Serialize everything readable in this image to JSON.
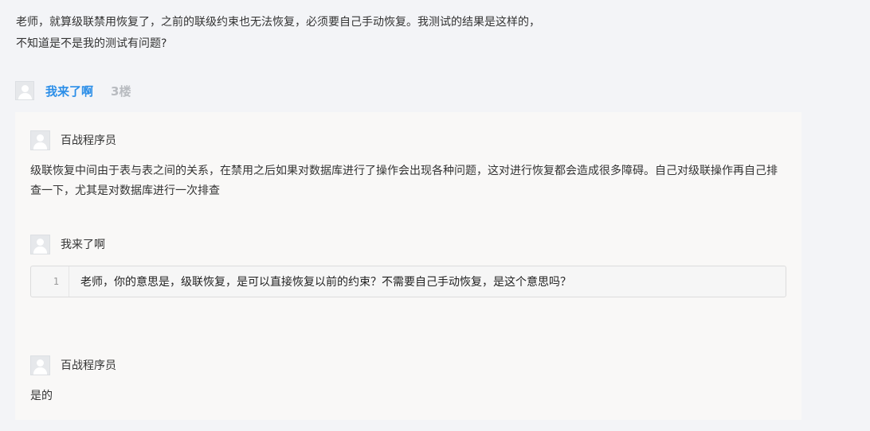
{
  "question": {
    "line1": "老师，就算级联禁用恢复了，之前的联级约束也无法恢复，必须要自己手动恢复。我测试的结果是这样的，",
    "line2": "不知道是不是我的测试有问题?"
  },
  "floor": {
    "username": "我来了啊",
    "floor_number": "3楼"
  },
  "replies": [
    {
      "author": "百战程序员",
      "text": "级联恢复中间由于表与表之间的关系，在禁用之后如果对数据库进行了操作会出现各种问题，这对进行恢复都会造成很多障碍。自己对级联操作再自己排查一下，尤其是对数据库进行一次排查"
    },
    {
      "author": "我来了啊",
      "code_line_number": "1",
      "code_text": "老师，你的意思是，级联恢复，是可以直接恢复以前的约束？不需要自己手动恢复，是这个意思吗？"
    },
    {
      "author": "百战程序员",
      "text": "是的"
    }
  ]
}
